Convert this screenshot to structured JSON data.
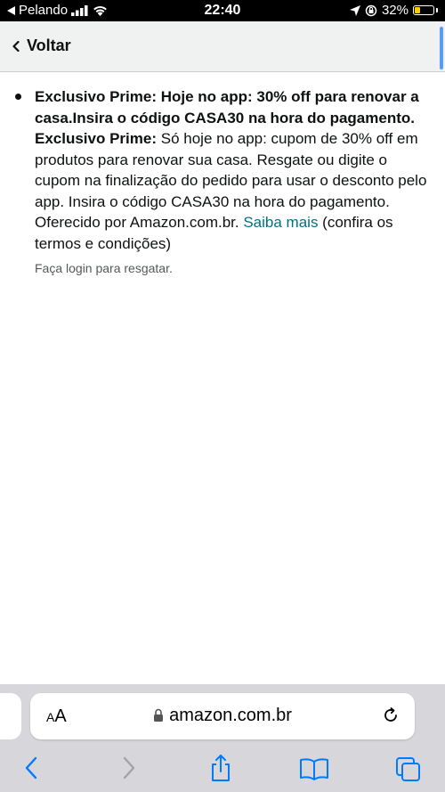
{
  "status_bar": {
    "back_app": "Pelando",
    "time": "22:40",
    "battery_percent": "32%",
    "battery_level": 0.32,
    "battery_color": "#ffcc00"
  },
  "header": {
    "back_label": "Voltar"
  },
  "promo": {
    "title": "Exclusivo Prime: Hoje no app: 30% off para renovar a casa.Insira o código CASA30 na hora do pagamento.",
    "desc_bold": "Exclusivo Prime:",
    "desc_text": " Só hoje no app: cupom de 30% off em produtos para renovar sua casa. Resgate ou digite o cupom na finalização do pedido para usar o desconto pelo app. Insira o código CASA30 na hora do pagamento. Oferecido por Amazon.com.br. ",
    "link_text": "Saiba mais",
    "terms_text": " (confira os termos e condições)",
    "login_hint": "Faça login para resgatar."
  },
  "browser": {
    "aa_small": "A",
    "aa_large": "A",
    "url": "amazon.com.br"
  },
  "colors": {
    "link": "#007185",
    "ios_blue": "#007aff",
    "toolbar_bg": "#d7d7db"
  }
}
